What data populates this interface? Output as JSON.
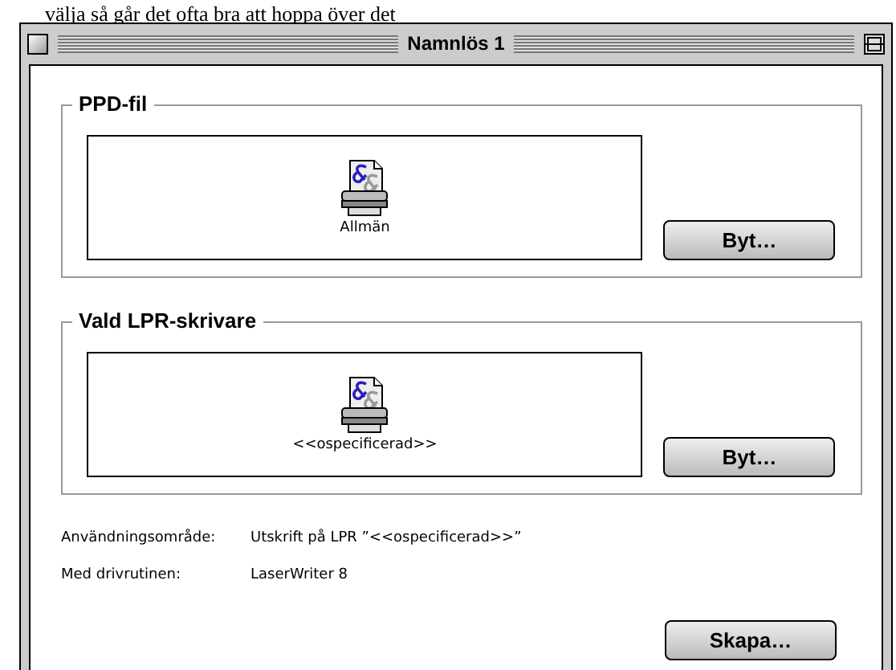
{
  "page_text": "välja så går det ofta bra att hoppa över det",
  "window": {
    "title": "Namnlös 1"
  },
  "groups": [
    {
      "title": "PPD-fil",
      "item": "Allmän",
      "button": "Byt…"
    },
    {
      "title": "Vald LPR-skrivare",
      "item": "<<ospecificerad>>",
      "button": "Byt…"
    }
  ],
  "info": [
    {
      "label": "Användningsområde:",
      "value": "Utskrift på LPR  ”<<ospecificerad>>”"
    },
    {
      "label": "Med drivrutinen:",
      "value": "LaserWriter 8"
    }
  ],
  "buttons": [
    "Skapa…"
  ]
}
